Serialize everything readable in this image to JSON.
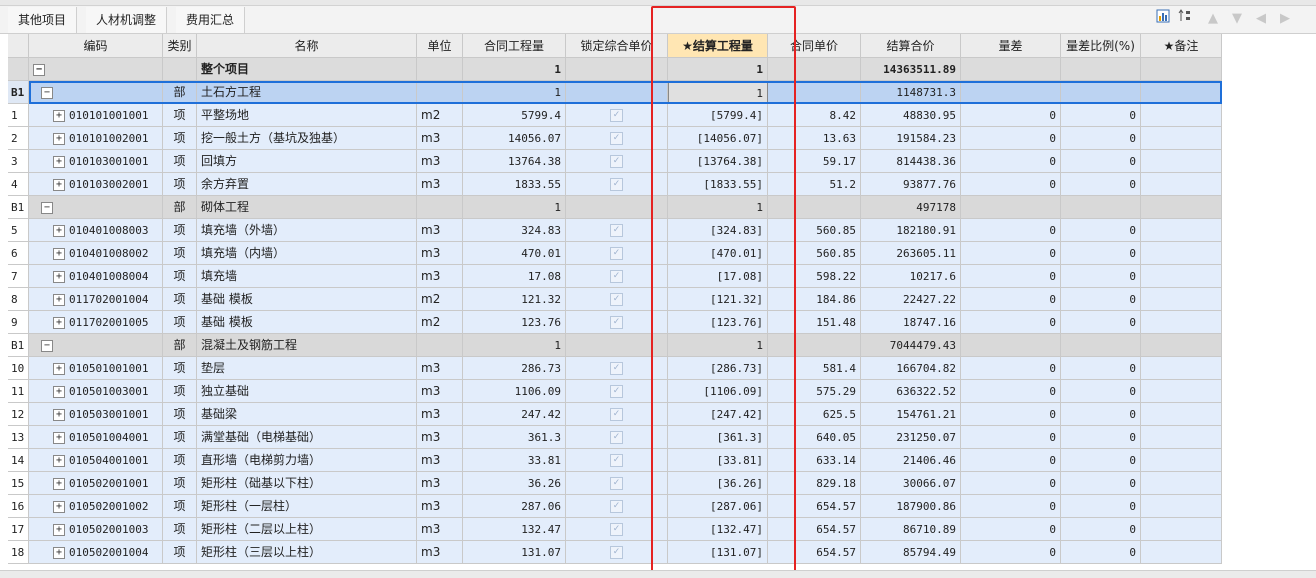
{
  "tabs": [
    {
      "label": "其他项目"
    },
    {
      "label": "人材机调整"
    },
    {
      "label": "费用汇总"
    }
  ],
  "toolbar": {
    "icons": [
      "chart-icon",
      "sort-icon",
      "arrow-up-icon",
      "arrow-down-icon",
      "arrow-left-icon",
      "arrow-right-icon"
    ]
  },
  "columns": [
    "编码",
    "类别",
    "名称",
    "单位",
    "合同工程量",
    "锁定综合单价",
    "★结算工程量",
    "合同单价",
    "结算合价",
    "量差",
    "量差比例(%)",
    "★备注"
  ],
  "rows": [
    {
      "kind": "top",
      "idx": "",
      "code": "",
      "type": "",
      "name": "整个项目",
      "unit": "",
      "qty": "1",
      "lock": "",
      "settle_qty": "1",
      "price": "",
      "total": "14363511.89",
      "diff": "",
      "ratio": "",
      "note": ""
    },
    {
      "kind": "dept",
      "sel": true,
      "idx": "B1",
      "code": "",
      "type": "部",
      "name": "土石方工程",
      "unit": "",
      "qty": "1",
      "lock": "",
      "settle_qty": "1",
      "price": "",
      "total": "1148731.3",
      "diff": "",
      "ratio": "",
      "note": ""
    },
    {
      "kind": "item",
      "idx": "1",
      "code": "010101001001",
      "type": "项",
      "name": "平整场地",
      "unit": "m2",
      "qty": "5799.4",
      "lock": "✓",
      "settle_qty": "[5799.4]",
      "price": "8.42",
      "total": "48830.95",
      "diff": "0",
      "ratio": "0",
      "note": ""
    },
    {
      "kind": "item",
      "idx": "2",
      "code": "010101002001",
      "type": "项",
      "name": "挖一般土方（基坑及独基）",
      "unit": "m3",
      "qty": "14056.07",
      "lock": "✓",
      "settle_qty": "[14056.07]",
      "price": "13.63",
      "total": "191584.23",
      "diff": "0",
      "ratio": "0",
      "note": ""
    },
    {
      "kind": "item",
      "idx": "3",
      "code": "010103001001",
      "type": "项",
      "name": "回填方",
      "unit": "m3",
      "qty": "13764.38",
      "lock": "✓",
      "settle_qty": "[13764.38]",
      "price": "59.17",
      "total": "814438.36",
      "diff": "0",
      "ratio": "0",
      "note": ""
    },
    {
      "kind": "item",
      "idx": "4",
      "code": "010103002001",
      "type": "项",
      "name": "余方弃置",
      "unit": "m3",
      "qty": "1833.55",
      "lock": "✓",
      "settle_qty": "[1833.55]",
      "price": "51.2",
      "total": "93877.76",
      "diff": "0",
      "ratio": "0",
      "note": ""
    },
    {
      "kind": "dept",
      "idx": "B1",
      "code": "",
      "type": "部",
      "name": "砌体工程",
      "unit": "",
      "qty": "1",
      "lock": "",
      "settle_qty": "1",
      "price": "",
      "total": "497178",
      "diff": "",
      "ratio": "",
      "note": ""
    },
    {
      "kind": "item",
      "idx": "5",
      "code": "010401008003",
      "type": "项",
      "name": "填充墙（外墙）",
      "unit": "m3",
      "qty": "324.83",
      "lock": "✓",
      "settle_qty": "[324.83]",
      "price": "560.85",
      "total": "182180.91",
      "diff": "0",
      "ratio": "0",
      "note": ""
    },
    {
      "kind": "item",
      "idx": "6",
      "code": "010401008002",
      "type": "项",
      "name": "填充墙（内墙）",
      "unit": "m3",
      "qty": "470.01",
      "lock": "✓",
      "settle_qty": "[470.01]",
      "price": "560.85",
      "total": "263605.11",
      "diff": "0",
      "ratio": "0",
      "note": ""
    },
    {
      "kind": "item",
      "idx": "7",
      "code": "010401008004",
      "type": "项",
      "name": "填充墙",
      "unit": "m3",
      "qty": "17.08",
      "lock": "✓",
      "settle_qty": "[17.08]",
      "price": "598.22",
      "total": "10217.6",
      "diff": "0",
      "ratio": "0",
      "note": ""
    },
    {
      "kind": "item",
      "idx": "8",
      "code": "011702001004",
      "type": "项",
      "name": "基础 模板",
      "unit": "m2",
      "qty": "121.32",
      "lock": "✓",
      "settle_qty": "[121.32]",
      "price": "184.86",
      "total": "22427.22",
      "diff": "0",
      "ratio": "0",
      "note": ""
    },
    {
      "kind": "item",
      "idx": "9",
      "code": "011702001005",
      "type": "项",
      "name": "基础 模板",
      "unit": "m2",
      "qty": "123.76",
      "lock": "✓",
      "settle_qty": "[123.76]",
      "price": "151.48",
      "total": "18747.16",
      "diff": "0",
      "ratio": "0",
      "note": ""
    },
    {
      "kind": "dept",
      "idx": "B1",
      "code": "",
      "type": "部",
      "name": "混凝土及钢筋工程",
      "unit": "",
      "qty": "1",
      "lock": "",
      "settle_qty": "1",
      "price": "",
      "total": "7044479.43",
      "diff": "",
      "ratio": "",
      "note": ""
    },
    {
      "kind": "item",
      "idx": "10",
      "code": "010501001001",
      "type": "项",
      "name": "垫层",
      "unit": "m3",
      "qty": "286.73",
      "lock": "✓",
      "settle_qty": "[286.73]",
      "price": "581.4",
      "total": "166704.82",
      "diff": "0",
      "ratio": "0",
      "note": ""
    },
    {
      "kind": "item",
      "idx": "11",
      "code": "010501003001",
      "type": "项",
      "name": "独立基础",
      "unit": "m3",
      "qty": "1106.09",
      "lock": "✓",
      "settle_qty": "[1106.09]",
      "price": "575.29",
      "total": "636322.52",
      "diff": "0",
      "ratio": "0",
      "note": ""
    },
    {
      "kind": "item",
      "idx": "12",
      "code": "010503001001",
      "type": "项",
      "name": "基础梁",
      "unit": "m3",
      "qty": "247.42",
      "lock": "✓",
      "settle_qty": "[247.42]",
      "price": "625.5",
      "total": "154761.21",
      "diff": "0",
      "ratio": "0",
      "note": ""
    },
    {
      "kind": "item",
      "idx": "13",
      "code": "010501004001",
      "type": "项",
      "name": "满堂基础（电梯基础）",
      "unit": "m3",
      "qty": "361.3",
      "lock": "✓",
      "settle_qty": "[361.3]",
      "price": "640.05",
      "total": "231250.07",
      "diff": "0",
      "ratio": "0",
      "note": ""
    },
    {
      "kind": "item",
      "idx": "14",
      "code": "010504001001",
      "type": "项",
      "name": "直形墙（电梯剪力墙）",
      "unit": "m3",
      "qty": "33.81",
      "lock": "✓",
      "settle_qty": "[33.81]",
      "price": "633.14",
      "total": "21406.46",
      "diff": "0",
      "ratio": "0",
      "note": ""
    },
    {
      "kind": "item",
      "idx": "15",
      "code": "010502001001",
      "type": "项",
      "name": "矩形柱（础基以下柱）",
      "unit": "m3",
      "qty": "36.26",
      "lock": "✓",
      "settle_qty": "[36.26]",
      "price": "829.18",
      "total": "30066.07",
      "diff": "0",
      "ratio": "0",
      "note": ""
    },
    {
      "kind": "item",
      "idx": "16",
      "code": "010502001002",
      "type": "项",
      "name": "矩形柱（一层柱）",
      "unit": "m3",
      "qty": "287.06",
      "lock": "✓",
      "settle_qty": "[287.06]",
      "price": "654.57",
      "total": "187900.86",
      "diff": "0",
      "ratio": "0",
      "note": ""
    },
    {
      "kind": "item",
      "idx": "17",
      "code": "010502001003",
      "type": "项",
      "name": "矩形柱（二层以上柱）",
      "unit": "m3",
      "qty": "132.47",
      "lock": "✓",
      "settle_qty": "[132.47]",
      "price": "654.57",
      "total": "86710.89",
      "diff": "0",
      "ratio": "0",
      "note": ""
    },
    {
      "kind": "item",
      "idx": "18",
      "code": "010502001004",
      "type": "项",
      "name": "矩形柱（三层以上柱）",
      "unit": "m3",
      "qty": "131.07",
      "lock": "✓",
      "settle_qty": "[131.07]",
      "price": "654.57",
      "total": "85794.49",
      "diff": "0",
      "ratio": "0",
      "note": ""
    }
  ]
}
